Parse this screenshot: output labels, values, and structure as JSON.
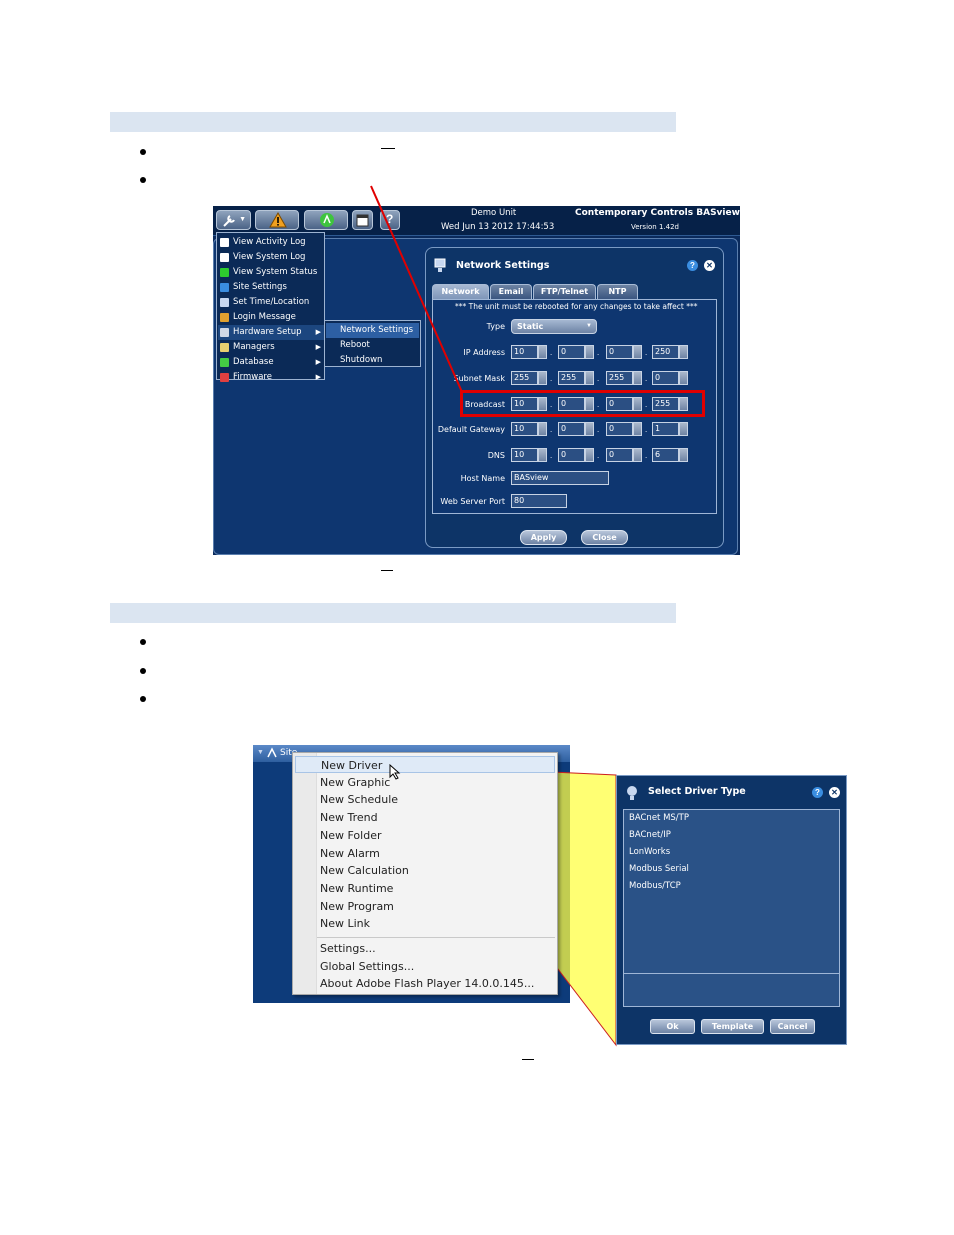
{
  "screenshot1": {
    "header": {
      "unit_name": "Demo Unit",
      "datetime": "Wed Jun 13 2012 17:44:53",
      "product_title": "Contemporary Controls BASview",
      "version": "Version 1.42d"
    },
    "tools_menu": [
      {
        "label": "View Activity Log",
        "icon": "document-icon",
        "color": "#ffffff"
      },
      {
        "label": "View System Log",
        "icon": "document-icon",
        "color": "#ffffff"
      },
      {
        "label": "View System Status",
        "icon": "checkmark-icon",
        "color": "#2ecc2e"
      },
      {
        "label": "Site Settings",
        "icon": "info-icon",
        "color": "#3a8de0"
      },
      {
        "label": "Set Time/Location",
        "icon": "clock-icon",
        "color": "#c8d8f0"
      },
      {
        "label": "Login Message",
        "icon": "note-icon",
        "color": "#e0a030"
      },
      {
        "label": "Hardware Setup",
        "icon": "tools-icon",
        "color": "#d0d8e6"
      },
      {
        "label": "Managers",
        "icon": "folder-icon",
        "color": "#e8d070"
      },
      {
        "label": "Database",
        "icon": "arrow-right-icon",
        "color": "#44cc44"
      },
      {
        "label": "Firmware",
        "icon": "arrow-up-icon",
        "color": "#e04040"
      }
    ],
    "hardware_submenu": [
      "Network Settings",
      "Reboot",
      "Shutdown"
    ],
    "network_dialog": {
      "title": "Network Settings",
      "tabs": [
        "Network",
        "Email",
        "FTP/Telnet",
        "NTP"
      ],
      "notice": "*** The unit must be rebooted for any changes to take affect ***",
      "type_label": "Type",
      "type_value": "Static",
      "rows": [
        {
          "label": "IP Address",
          "octets": [
            "10",
            "0",
            "0",
            "250"
          ]
        },
        {
          "label": "Subnet Mask",
          "octets": [
            "255",
            "255",
            "255",
            "0"
          ]
        },
        {
          "label": "Broadcast",
          "octets": [
            "10",
            "0",
            "0",
            "255"
          ]
        },
        {
          "label": "Default Gateway",
          "octets": [
            "10",
            "0",
            "0",
            "1"
          ]
        },
        {
          "label": "DNS",
          "octets": [
            "10",
            "0",
            "0",
            "6"
          ]
        }
      ],
      "host_name_label": "Host Name",
      "host_name_value": "BASview",
      "web_port_label": "Web Server Port",
      "web_port_value": "80",
      "apply_label": "Apply",
      "close_label": "Close"
    },
    "highlight_color": "#e00000"
  },
  "screenshot2": {
    "tree_root_label": "Site",
    "context_menu": {
      "items": [
        "New Driver",
        "New Graphic",
        "New Schedule",
        "New Trend",
        "New Folder",
        "New Alarm",
        "New Calculation",
        "New Runtime",
        "New Program",
        "New Link"
      ],
      "extra_items": [
        "Settings...",
        "Global Settings...",
        "About Adobe Flash Player 14.0.0.145..."
      ]
    },
    "driver_dialog": {
      "title": "Select Driver Type",
      "options": [
        "BACnet MS/TP",
        "BACnet/IP",
        "LonWorks",
        "Modbus Serial",
        "Modbus/TCP"
      ],
      "ok_label": "Ok",
      "template_label": "Template",
      "cancel_label": "Cancel"
    },
    "callout_color": "#ffff33"
  }
}
